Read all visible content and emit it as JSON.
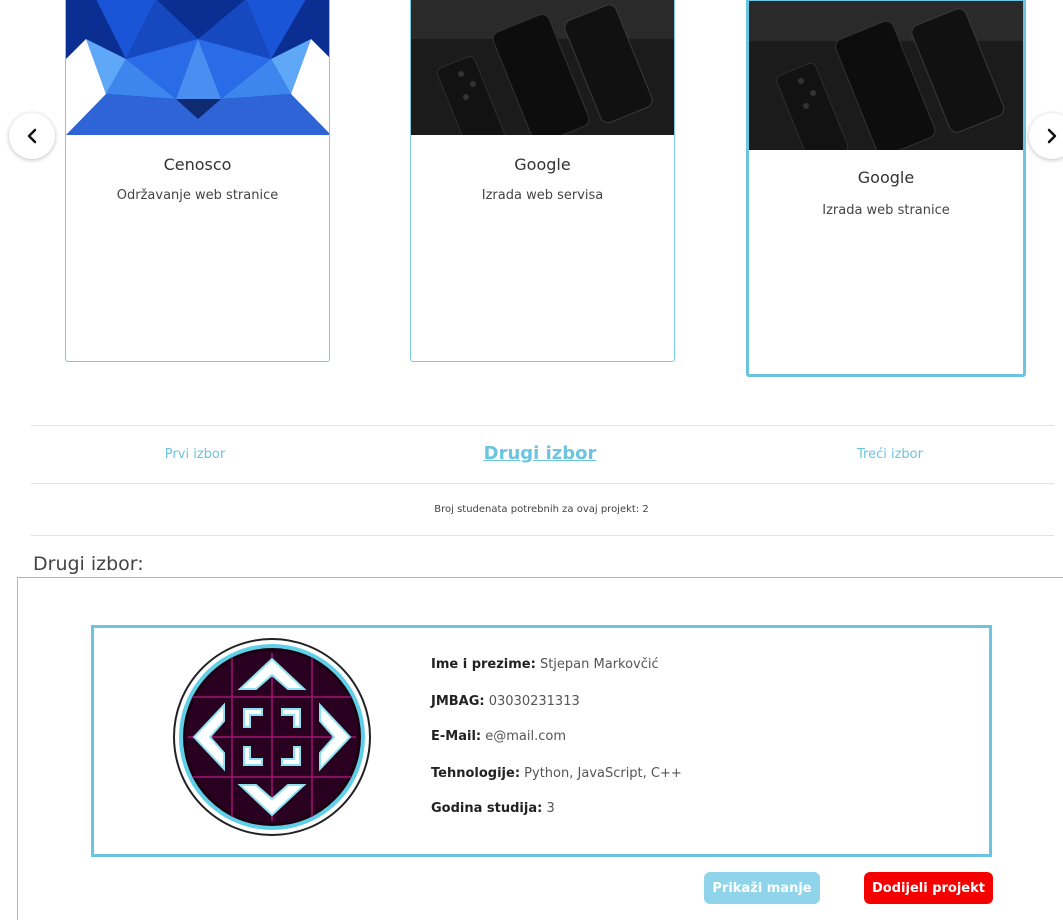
{
  "carousel": {
    "prev_icon": "chevron-left-icon",
    "next_icon": "chevron-right-icon",
    "cards": [
      {
        "title": "Cenosco",
        "subtitle": "Održavanje web stranice",
        "image": "blue-wolf-lowpoly-image"
      },
      {
        "title": "Google",
        "subtitle": "Izrada web servisa",
        "image": "dark-phones-image"
      },
      {
        "title": "Google",
        "subtitle": "Izrada web stranice",
        "image": "dark-phones-image"
      }
    ]
  },
  "tabs": {
    "first": "Prvi izbor",
    "second": "Drugi izbor",
    "third": "Treći izbor"
  },
  "student_count": "Broj studenata potrebnih za ovaj projekt: 2",
  "section_title": "Drugi izbor:",
  "profile": {
    "name_label": "Ime i prezime:",
    "name_value": " Stjepan Markovčić",
    "jmbag_label": "JMBAG:",
    "jmbag_value": " 03030231313",
    "email_label": "E-Mail:",
    "email_value": " e@mail.com",
    "tech_label": "Tehnologije:",
    "tech_value": " Python, JavaScript, C++",
    "year_label": "Godina studija:",
    "year_value": " 3"
  },
  "buttons": {
    "show_less": "Prikaži manje",
    "assign": "Dodijeli projekt"
  },
  "colors": {
    "accent": "#6cc4e0",
    "danger": "#f40000",
    "light_accent": "#8fd4ea"
  }
}
